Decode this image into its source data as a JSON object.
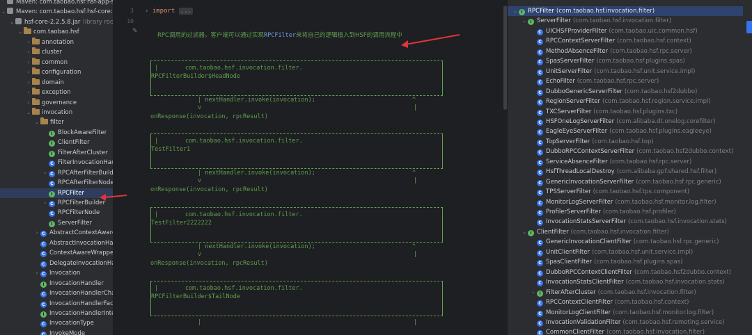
{
  "left_tree": {
    "items": [
      {
        "label": "Maven: com.taobao.hsf:hsf-app-sp",
        "depth": 0,
        "kind": "lib",
        "arrow": ""
      },
      {
        "label": "Maven: com.taobao.hsf:hsf-core:2.",
        "depth": 0,
        "kind": "lib",
        "arrow": "v"
      },
      {
        "label": "hsf-core-2.2.5.8.jar",
        "suffix": "library root",
        "depth": 1,
        "kind": "jar",
        "arrow": "v"
      },
      {
        "label": "com.taobao.hsf",
        "depth": 2,
        "kind": "folder",
        "arrow": "v"
      },
      {
        "label": "annotation",
        "depth": 3,
        "kind": "folder",
        "arrow": ">"
      },
      {
        "label": "cluster",
        "depth": 3,
        "kind": "folder",
        "arrow": ">"
      },
      {
        "label": "common",
        "depth": 3,
        "kind": "folder",
        "arrow": ">"
      },
      {
        "label": "configuration",
        "depth": 3,
        "kind": "folder",
        "arrow": ">"
      },
      {
        "label": "domain",
        "depth": 3,
        "kind": "folder",
        "arrow": ">"
      },
      {
        "label": "exception",
        "depth": 3,
        "kind": "folder",
        "arrow": ">"
      },
      {
        "label": "governance",
        "depth": 3,
        "kind": "folder",
        "arrow": ">"
      },
      {
        "label": "invocation",
        "depth": 3,
        "kind": "folder",
        "arrow": "v"
      },
      {
        "label": "filter",
        "depth": 4,
        "kind": "folder",
        "arrow": "v"
      },
      {
        "label": "BlockAwareFilter",
        "depth": 5,
        "kind": "i",
        "arrow": ""
      },
      {
        "label": "ClientFilter",
        "depth": 5,
        "kind": "i",
        "arrow": ""
      },
      {
        "label": "FilterAfterCluster",
        "depth": 5,
        "kind": "i",
        "arrow": ""
      },
      {
        "label": "FilterInvocationHand",
        "depth": 5,
        "kind": "c",
        "arrow": ""
      },
      {
        "label": "RPCAfterFilterBuilde",
        "depth": 5,
        "kind": "c",
        "arrow": ">"
      },
      {
        "label": "RPCAfterFilterNode",
        "depth": 5,
        "kind": "c",
        "arrow": ""
      },
      {
        "label": "RPCFilter",
        "depth": 5,
        "kind": "i",
        "arrow": "",
        "selected": true
      },
      {
        "label": "RPCFilterBuilder",
        "depth": 5,
        "kind": "c",
        "arrow": ">"
      },
      {
        "label": "RPCFilterNode",
        "depth": 5,
        "kind": "c",
        "arrow": ""
      },
      {
        "label": "ServerFilter",
        "depth": 5,
        "kind": "i",
        "arrow": ""
      },
      {
        "label": "AbstractContextAwareI",
        "depth": 4,
        "kind": "c",
        "arrow": ">"
      },
      {
        "label": "AbstractInvocationHand",
        "depth": 4,
        "kind": "c",
        "arrow": ""
      },
      {
        "label": "ContextAwareWrapper",
        "depth": 4,
        "kind": "c",
        "arrow": ""
      },
      {
        "label": "DelegateInvocationHan",
        "depth": 4,
        "kind": "c",
        "arrow": ""
      },
      {
        "label": "Invocation",
        "depth": 4,
        "kind": "c",
        "arrow": ">"
      },
      {
        "label": "InvocationHandler",
        "depth": 4,
        "kind": "i",
        "arrow": ""
      },
      {
        "label": "InvocationHandlerChain",
        "depth": 4,
        "kind": "c",
        "arrow": ""
      },
      {
        "label": "InvocationHandlerFacto",
        "depth": 4,
        "kind": "c",
        "arrow": ""
      },
      {
        "label": "InvocationHandlerInter",
        "depth": 4,
        "kind": "i",
        "arrow": ""
      },
      {
        "label": "InvocationType",
        "depth": 4,
        "kind": "c",
        "arrow": ""
      },
      {
        "label": "InvokeMode",
        "depth": 4,
        "kind": "c",
        "arrow": ""
      }
    ]
  },
  "editor": {
    "line_numbers": [
      "3",
      "10"
    ],
    "import_kw": "import",
    "import_fold": "...",
    "doc_comment_pre": "RPC调用的过滤器。客户端可以通过实现",
    "doc_comment_code": "RPCFilter",
    "doc_comment_post": "来将自己的逻辑植入到HSF的调用流程中",
    "boxes": [
      {
        "line1": "       com.taobao.hsf.invocation.filter.",
        "line2": "RPCFilterBuilder$HeadNode"
      },
      {
        "line1": "       com.taobao.hsf.invocation.filter.",
        "line2": "TestFilter1"
      },
      {
        "line1": "       com.taobao.hsf.invocation.filter.",
        "line2": "TestFilter2222222"
      },
      {
        "line1": "       com.taobao.hsf.invocation.filter.",
        "line2": "RPCFilterBuilder$TailNode"
      }
    ],
    "next_handler": "nextHandler.invoke(invocation);",
    "on_response": "onResponse(invocation, rpcResult)",
    "arrow_v": "v",
    "arrow_up": "^",
    "pipe": "|"
  },
  "hierarchy": {
    "items": [
      {
        "name": "RPCFilter",
        "pkg": "(com.taobao.hsf.invocation.filter)",
        "depth": 0,
        "kind": "i",
        "arrow": "v",
        "selected": true
      },
      {
        "name": "ServerFilter",
        "pkg": "(com.taobao.hsf.invocation.filter)",
        "depth": 1,
        "kind": "i",
        "arrow": "v"
      },
      {
        "name": "UICHSFProviderFilter",
        "pkg": "(com.taobao.uic.common.hsf)",
        "depth": 2,
        "kind": "c",
        "arrow": ""
      },
      {
        "name": "RPCContextServerFilter",
        "pkg": "(com.taobao.hsf.context)",
        "depth": 2,
        "kind": "c",
        "arrow": ""
      },
      {
        "name": "MethodAbsenceFilter",
        "pkg": "(com.taobao.hsf.rpc.server)",
        "depth": 2,
        "kind": "c",
        "arrow": ""
      },
      {
        "name": "SpasServerFilter",
        "pkg": "(com.taobao.hsf.plugins.spas)",
        "depth": 2,
        "kind": "c",
        "arrow": ""
      },
      {
        "name": "UnitServerFilter",
        "pkg": "(com.taobao.hsf.unit.service.impl)",
        "depth": 2,
        "kind": "c",
        "arrow": ""
      },
      {
        "name": "EchoFilter",
        "pkg": "(com.taobao.hsf.rpc.server)",
        "depth": 2,
        "kind": "c",
        "arrow": ""
      },
      {
        "name": "DubboGenericServerFilter",
        "pkg": "(com.taobao.hsf2dubbo)",
        "depth": 2,
        "kind": "c",
        "arrow": ""
      },
      {
        "name": "RegionServerFilter",
        "pkg": "(com.taobao.hsf.region.service.impl)",
        "depth": 2,
        "kind": "c",
        "arrow": ""
      },
      {
        "name": "TXCServerFilter",
        "pkg": "(com.taobao.hsf.plugins.txc)",
        "depth": 2,
        "kind": "c",
        "arrow": ""
      },
      {
        "name": "HSFOneLogServerFilter",
        "pkg": "(com.alibaba.dt.onelog.corefilter)",
        "depth": 2,
        "kind": "c",
        "arrow": ""
      },
      {
        "name": "EagleEyeServerFilter",
        "pkg": "(com.taobao.hsf.plugins.eagleeye)",
        "depth": 2,
        "kind": "c",
        "arrow": ""
      },
      {
        "name": "TopServerFilter",
        "pkg": "(com.taobao.hsf.top)",
        "depth": 2,
        "kind": "c",
        "arrow": ""
      },
      {
        "name": "DubboRPCContextServerFilter",
        "pkg": "(com.taobao.hsf2dubbo.context)",
        "depth": 2,
        "kind": "c",
        "arrow": ""
      },
      {
        "name": "ServiceAbsenceFilter",
        "pkg": "(com.taobao.hsf.rpc.server)",
        "depth": 2,
        "kind": "c",
        "arrow": ""
      },
      {
        "name": "HsfThreadLocalDestroy",
        "pkg": "(com.alibaba.gpf.shared.hsf.filter)",
        "depth": 2,
        "kind": "c",
        "arrow": ""
      },
      {
        "name": "GenericInvocationServerFilter",
        "pkg": "(com.taobao.hsf.rpc.generic)",
        "depth": 2,
        "kind": "c",
        "arrow": ""
      },
      {
        "name": "TPSServerFilter",
        "pkg": "(com.taobao.hsf.tps.component)",
        "depth": 2,
        "kind": "c",
        "arrow": ""
      },
      {
        "name": "MonitorLogServerFilter",
        "pkg": "(com.taobao.hsf.monitor.log.filter)",
        "depth": 2,
        "kind": "c",
        "arrow": ""
      },
      {
        "name": "ProfilerServerFilter",
        "pkg": "(com.taobao.hsf.profiler)",
        "depth": 2,
        "kind": "c",
        "arrow": ""
      },
      {
        "name": "InvocationStatsServerFilter",
        "pkg": "(com.taobao.hsf.invocation.stats)",
        "depth": 2,
        "kind": "c",
        "arrow": ""
      },
      {
        "name": "ClientFilter",
        "pkg": "(com.taobao.hsf.invocation.filter)",
        "depth": 1,
        "kind": "i",
        "arrow": "v"
      },
      {
        "name": "GenericInvocationClientFilter",
        "pkg": "(com.taobao.hsf.rpc.generic)",
        "depth": 2,
        "kind": "c",
        "arrow": ""
      },
      {
        "name": "UnitClientFilter",
        "pkg": "(com.taobao.hsf.unit.service.impl)",
        "depth": 2,
        "kind": "c",
        "arrow": ""
      },
      {
        "name": "SpasClientFilter",
        "pkg": "(com.taobao.hsf.plugins.spas)",
        "depth": 2,
        "kind": "c",
        "arrow": ""
      },
      {
        "name": "DubboRPCContextClientFilter",
        "pkg": "(com.taobao.hsf2dubbo.context)",
        "depth": 2,
        "kind": "c",
        "arrow": ""
      },
      {
        "name": "InvocationStatsClientFilter",
        "pkg": "(com.taobao.hsf.invocation.stats)",
        "depth": 2,
        "kind": "c",
        "arrow": ""
      },
      {
        "name": "FilterAfterCluster",
        "pkg": "(com.taobao.hsf.invocation.filter)",
        "depth": 2,
        "kind": "i",
        "arrow": ">"
      },
      {
        "name": "RPCContextClientFilter",
        "pkg": "(com.taobao.hsf.context)",
        "depth": 2,
        "kind": "c",
        "arrow": ""
      },
      {
        "name": "MonitorLogClientFilter",
        "pkg": "(com.taobao.hsf.monitor.log.filter)",
        "depth": 2,
        "kind": "c",
        "arrow": ""
      },
      {
        "name": "InvocationValidationFilter",
        "pkg": "(com.taobao.hsf.remoting.service)",
        "depth": 2,
        "kind": "c",
        "arrow": ""
      },
      {
        "name": "CommonClientFilter",
        "pkg": "(com.taobao.hsf.invocation.filter)",
        "depth": 2,
        "kind": "c",
        "arrow": ""
      }
    ]
  },
  "colors": {
    "accent": "#3574f0",
    "annotation_arrow": "#e0343b",
    "comment": "#5f9e4f"
  }
}
